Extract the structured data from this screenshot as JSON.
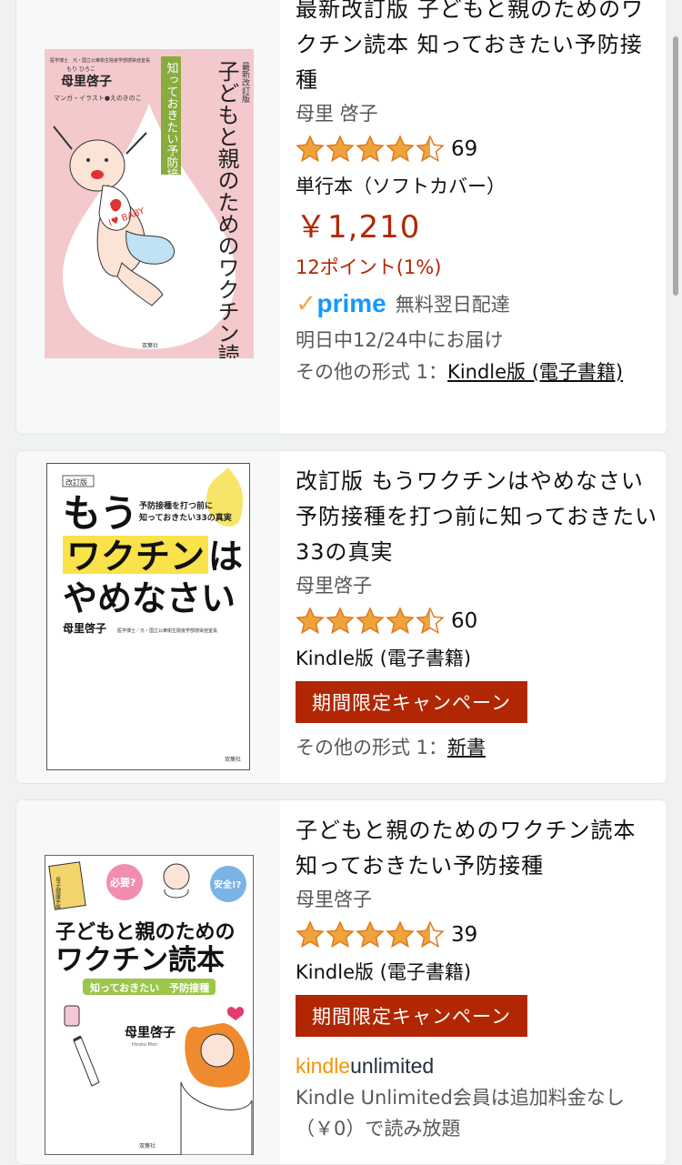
{
  "results": [
    {
      "title": "最新改訂版 子どもと親のためのワクチン読本 知っておきたい予防接種",
      "author": "母里 啓子",
      "rating_count": "69",
      "format": "単行本（ソフトカバー）",
      "price": "￥1,210",
      "points": "12ポイント(1%)",
      "prime_text": "無料翌日配達",
      "delivery": "明日中12/24中にお届け",
      "other_prefix": "その他の形式 1：",
      "other_link": "Kindle版 (電子書籍)",
      "cover": {
        "edition": "最新改訂版",
        "title": "子どもと親のためのワクチン読本",
        "subtitle": "知っておきたい予防接種",
        "author": "母里啓子",
        "author_ruby": "もり ひろこ",
        "author_note": "医学博士　元・国立公衆衛生院疫学部感染症室長",
        "illustrator": "マンガ・イラスト●えのきのこ",
        "bib": "I♥ BABY",
        "publisher": "双葉社"
      }
    },
    {
      "title": "改訂版 もうワクチンはやめなさい　予防接種を打つ前に知っておきたい33の真実",
      "author": "母里啓子",
      "rating_count": "60",
      "format": "Kindle版 (電子書籍)",
      "deal": "期間限定キャンペーン",
      "other_prefix": "その他の形式 1：",
      "other_link": "新書",
      "cover": {
        "edition": "改訂版",
        "line1": "もう",
        "highlight": "ワクチン",
        "ha": "は",
        "line3": "やめなさい",
        "sub1": "予防接種を打つ前に",
        "sub2": "知っておきたい33の真実",
        "author": "母里啓子",
        "author_note": "医学博士／元・国立公衆衛生院疫学部感染症室長",
        "publisher": "双葉社"
      }
    },
    {
      "title": "子どもと親のためのワクチン読本 知っておきたい予防接種",
      "author": "母里啓子",
      "rating_count": "39",
      "format": "Kindle版 (電子書籍)",
      "deal": "期間限定キャンペーン",
      "ku_kindle": "kindle",
      "ku_unlimited": "unlimited",
      "ku_note": "Kindle Unlimited会員は追加料金なし（￥0）で読み放題",
      "cover": {
        "q1": "必要?",
        "q2": "安全!?",
        "booklet": "母子健康手帳",
        "title1": "子どもと親のための",
        "title2": "ワクチン読本",
        "subtitle": "知っておきたい　予防接種",
        "author": "母里啓子",
        "author_roman": "Hiroko Mori",
        "publisher": "双葉社"
      }
    }
  ],
  "prime_check": "✓",
  "prime_word": "prime",
  "colors": {
    "price": "#b12704",
    "star": "#f0a33a",
    "prime": "#1399ff",
    "deal_bg": "#b12704"
  },
  "rating_stars": 4.5
}
